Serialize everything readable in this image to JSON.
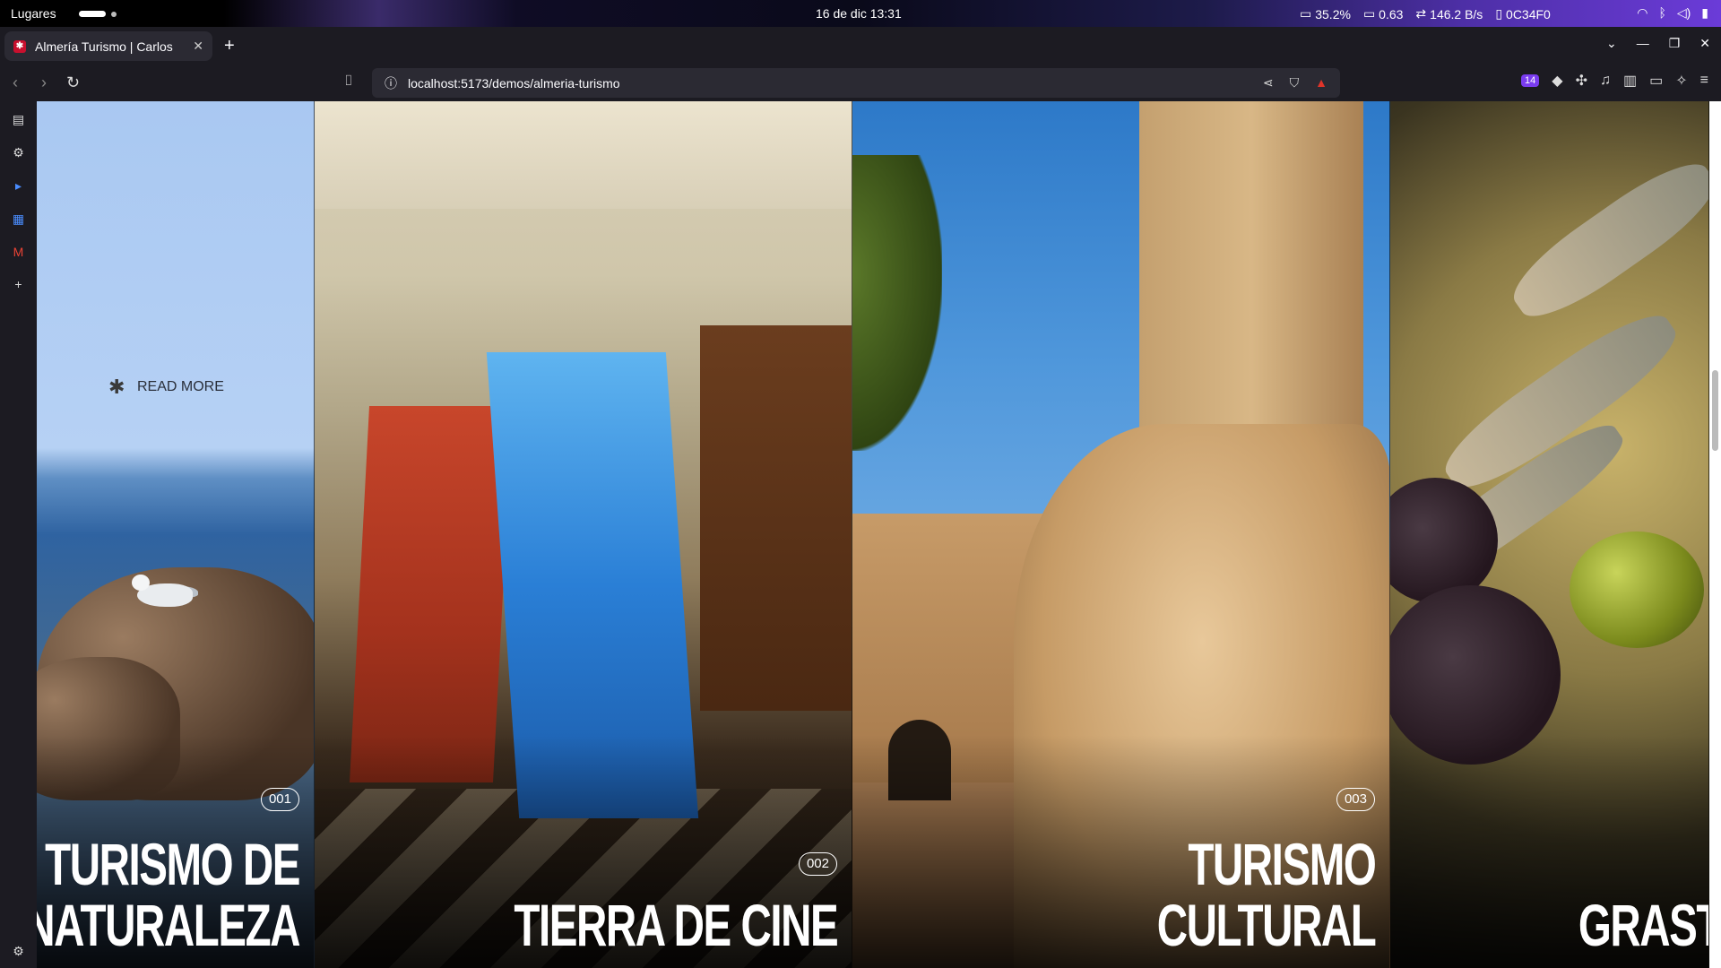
{
  "os": {
    "places": "Lugares",
    "clock": "16 de dic  13:31",
    "stats": {
      "cpu": "35.2%",
      "load": "0.63",
      "net": "146.2 B/s",
      "color": "0C34F0"
    }
  },
  "browser": {
    "tab_title": "Almería Turismo | Carlos",
    "url": "localhost:5173/demos/almeria-turismo",
    "extension_badge": "14"
  },
  "page": {
    "read_more": "READ MORE",
    "panels": [
      {
        "number": "001",
        "title_line1": "TURISMO DE",
        "title_line2": "NATURALEZA"
      },
      {
        "number": "002",
        "title_line1": "TIERRA DE CINE"
      },
      {
        "number": "003",
        "title_line1": "TURISMO",
        "title_line2": "CULTURAL"
      },
      {
        "title_line1": "GRAST"
      }
    ]
  },
  "icons": {
    "tab_close": "close-icon",
    "new_tab": "plus-icon"
  }
}
